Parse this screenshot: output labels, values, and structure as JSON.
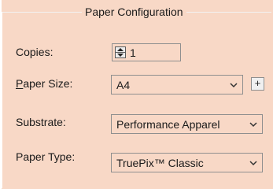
{
  "group": {
    "title": "Paper Configuration"
  },
  "copies": {
    "label": "Copies:",
    "value": "1"
  },
  "paper_size": {
    "label_mnemonic": "P",
    "label_rest": "aper Size:",
    "value": "A4",
    "add_label": "+"
  },
  "substrate": {
    "label": "Substrate:",
    "value": "Performance Apparel"
  },
  "paper_type": {
    "label": "Paper Type:",
    "value": "TruePix™ Classic"
  },
  "icons": {
    "spinner": "up-down-arrows-icon",
    "dropdown": "chevron-down-icon"
  },
  "colors": {
    "panel_background": "#f8d8c6",
    "border": "#8f8f8f"
  }
}
